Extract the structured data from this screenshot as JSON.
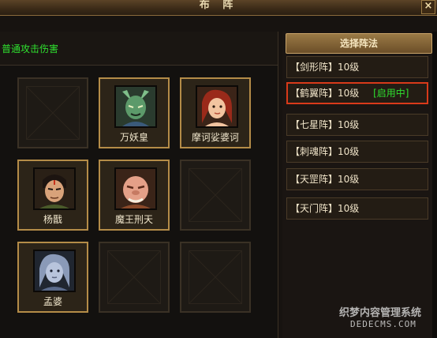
{
  "window": {
    "title": "布 阵",
    "close_label": "×"
  },
  "left": {
    "effect_text": "普通攻击伤害",
    "slots": [
      {
        "name": ""
      },
      {
        "name": "万妖皇",
        "portrait": "green-demon"
      },
      {
        "name": "摩诃娑婆诃",
        "portrait": "red-hair-woman"
      },
      {
        "name": "杨戬",
        "portrait": "warrior-man"
      },
      {
        "name": "魔王刑天",
        "portrait": "bald-ogre"
      },
      {
        "name": ""
      },
      {
        "name": "孟婆",
        "portrait": "pale-woman"
      },
      {
        "name": ""
      },
      {
        "name": ""
      }
    ]
  },
  "right": {
    "header": "选择阵法",
    "formations": [
      {
        "label": "【剑形阵】10级",
        "badge": ""
      },
      {
        "label": "【鹤翼阵】10级",
        "badge": "[启用中]"
      },
      {
        "label": "【七星阵】10级",
        "badge": ""
      },
      {
        "label": "【刺魂阵】10级",
        "badge": ""
      },
      {
        "label": "【天罡阵】10级",
        "badge": ""
      },
      {
        "label": "【天门阵】10级",
        "badge": ""
      }
    ]
  },
  "watermark": {
    "line1": "织梦内容管理系统",
    "line2": "DEDECMS.COM"
  },
  "colors": {
    "effect_green": "#2fe02f",
    "active_border": "#d83a1a",
    "slot_gold": "#b48c48"
  }
}
